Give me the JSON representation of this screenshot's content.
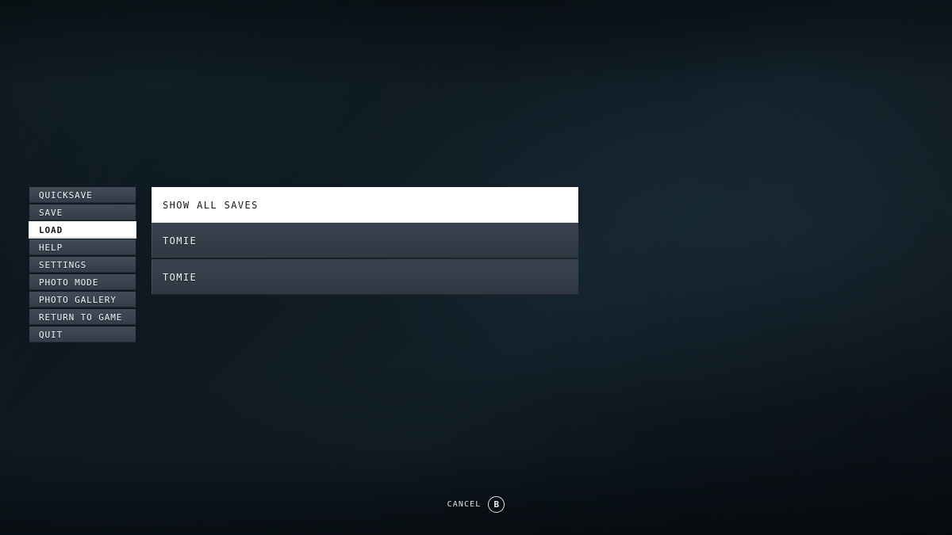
{
  "screen": {
    "name": "pause-menu-load",
    "background_color": "#0b151c",
    "accent_color": "#ffffff",
    "panel_color": "#343d48"
  },
  "sidebar": {
    "items": [
      {
        "label": "QUICKSAVE",
        "selected": false
      },
      {
        "label": "SAVE",
        "selected": false
      },
      {
        "label": "LOAD",
        "selected": true
      },
      {
        "label": "HELP",
        "selected": false
      },
      {
        "label": "SETTINGS",
        "selected": false
      },
      {
        "label": "PHOTO MODE",
        "selected": false
      },
      {
        "label": "PHOTO GALLERY",
        "selected": false
      },
      {
        "label": "RETURN TO GAME",
        "selected": false
      },
      {
        "label": "QUIT",
        "selected": false
      }
    ]
  },
  "save_list": {
    "header_label": "SHOW ALL SAVES",
    "rows": [
      {
        "label": "TOMIE"
      },
      {
        "label": "TOMIE"
      }
    ]
  },
  "footer": {
    "cancel_label": "CANCEL",
    "cancel_button_glyph": "B"
  }
}
